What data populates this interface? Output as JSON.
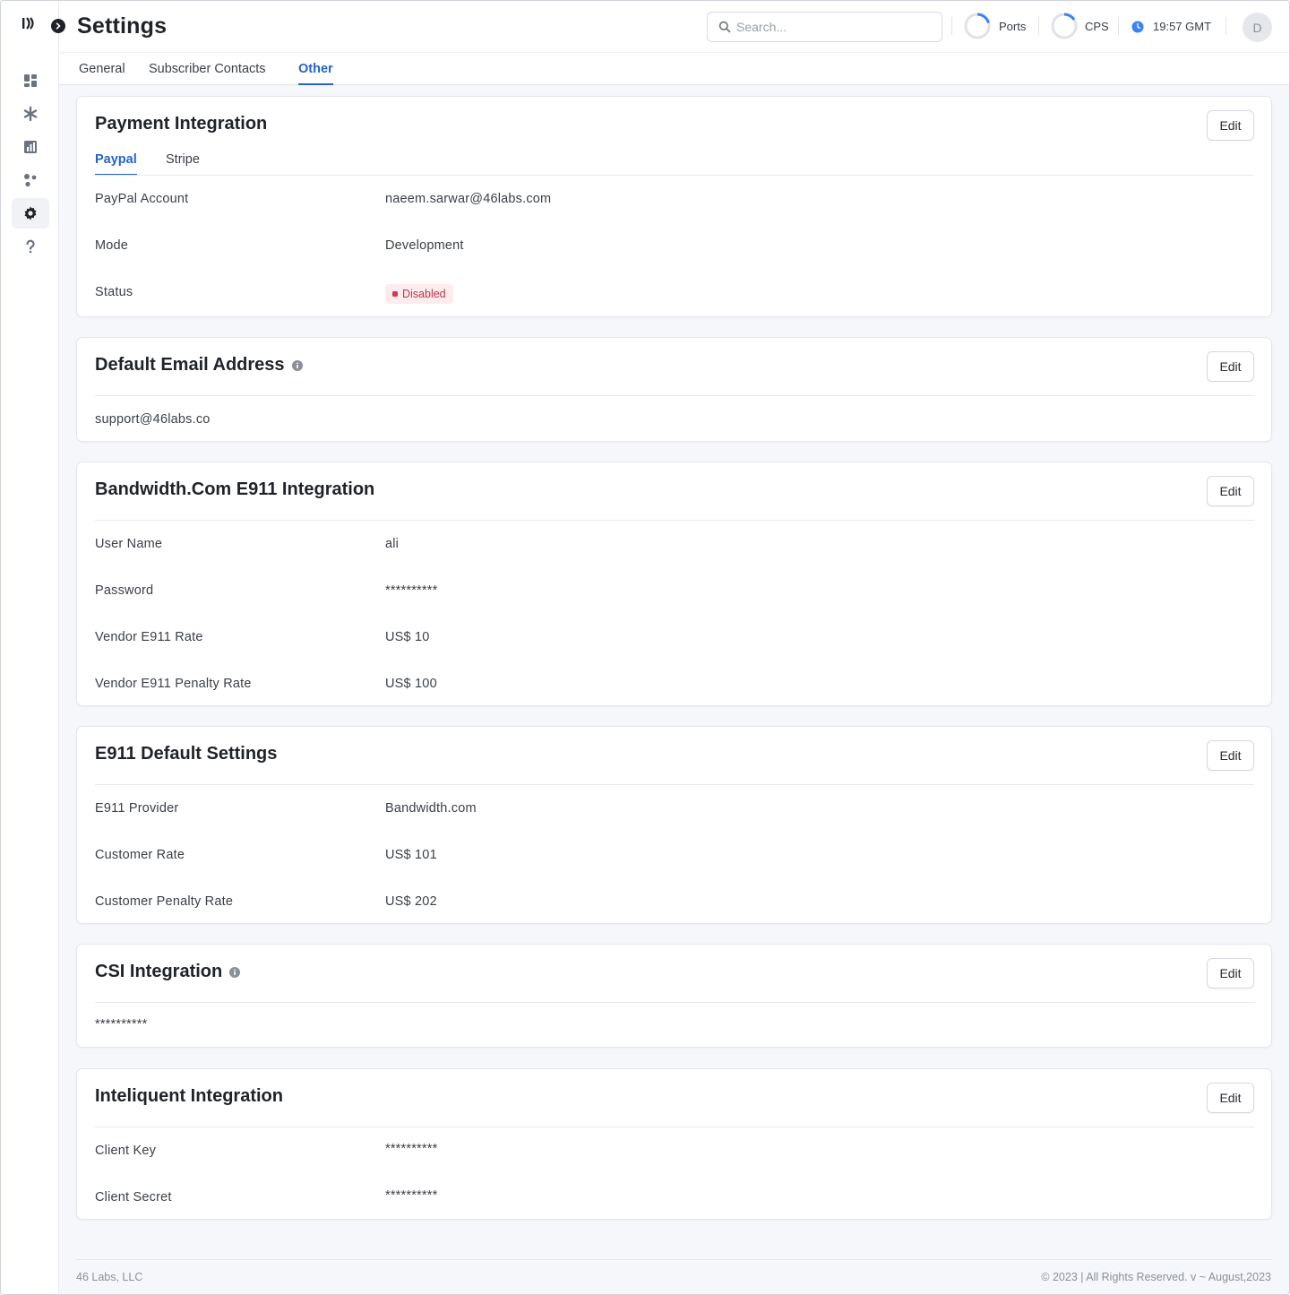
{
  "header": {
    "title": "Settings",
    "search_placeholder": "Search...",
    "ports_label": "Ports",
    "cps_label": "CPS",
    "time": "19:57 GMT",
    "avatar_initial": "D"
  },
  "sidebar": {
    "items": [
      {
        "icon": "dashboard-icon"
      },
      {
        "icon": "asterisk-icon"
      },
      {
        "icon": "report-icon"
      },
      {
        "icon": "network-icon"
      },
      {
        "icon": "gear-icon",
        "active": true
      },
      {
        "icon": "help-icon"
      }
    ]
  },
  "tabs": [
    {
      "label": "General"
    },
    {
      "label": "Subscriber Contacts"
    },
    {
      "label": "Other",
      "active": true
    }
  ],
  "payment": {
    "title": "Payment Integration",
    "edit_label": "Edit",
    "subtabs": [
      {
        "label": "Paypal",
        "active": true
      },
      {
        "label": "Stripe"
      }
    ],
    "rows": [
      {
        "label": "PayPal Account",
        "value": "naeem.sarwar@46labs.com"
      },
      {
        "label": "Mode",
        "value": "Development"
      },
      {
        "label": "Status",
        "value": "Disabled"
      }
    ]
  },
  "default_email": {
    "title": "Default Email Address",
    "edit_label": "Edit",
    "value": "support@46labs.co"
  },
  "bandwidth": {
    "title": "Bandwidth.Com E911 Integration",
    "edit_label": "Edit",
    "rows": [
      {
        "label": "User Name",
        "value": "ali"
      },
      {
        "label": "Password",
        "value": "**********"
      },
      {
        "label": "Vendor E911 Rate",
        "value": "US$ 10"
      },
      {
        "label": "Vendor E911 Penalty Rate",
        "value": "US$ 100"
      }
    ]
  },
  "e911_defaults": {
    "title": "E911 Default Settings",
    "edit_label": "Edit",
    "rows": [
      {
        "label": "E911 Provider",
        "value": "Bandwidth.com"
      },
      {
        "label": "Customer Rate",
        "value": "US$ 101"
      },
      {
        "label": "Customer Penalty Rate",
        "value": "US$ 202"
      }
    ]
  },
  "csi": {
    "title": "CSI Integration",
    "edit_label": "Edit",
    "value": "**********"
  },
  "inteliquent": {
    "title": "Inteliquent Integration",
    "edit_label": "Edit",
    "rows": [
      {
        "label": "Client Key",
        "value": "**********"
      },
      {
        "label": "Client Secret",
        "value": "**********"
      }
    ]
  },
  "footer": {
    "company": "46 Labs, LLC",
    "copyright": "© 2023 | All Rights Reserved. v ~ August,2023"
  },
  "colors": {
    "accent": "#2563c9",
    "status_disabled": "#c0344a",
    "ring_progress": "#3b82f6"
  }
}
